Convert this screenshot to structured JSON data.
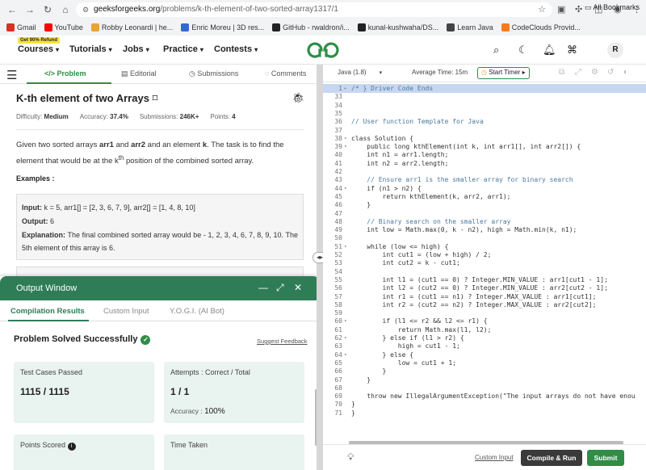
{
  "browser": {
    "url_host": "geeksforgeeks.org",
    "url_path": "/problems/k-th-element-of-two-sorted-array1317/1",
    "bookmarks": [
      {
        "label": "Gmail",
        "color": "#d93025"
      },
      {
        "label": "YouTube",
        "color": "#ff0000"
      },
      {
        "label": "Robby Leonardi | he...",
        "color": "#e8a33a"
      },
      {
        "label": "Enric Moreu | 3D res...",
        "color": "#3367d6"
      },
      {
        "label": "GitHub - rwaldron/i...",
        "color": "#222222"
      },
      {
        "label": "kunal-kushwaha/DS...",
        "color": "#222222"
      },
      {
        "label": "Learn Java",
        "color": "#444444"
      },
      {
        "label": "CodeClouds Provid...",
        "color": "#f47b20"
      }
    ],
    "all_bookmarks": "All Bookmarks"
  },
  "header": {
    "refund_badge": "Get 90% Refund",
    "nav": [
      "Courses",
      "Tutorials",
      "Jobs",
      "Practice",
      "Contests"
    ],
    "avatar": "R"
  },
  "problem": {
    "tabs": [
      "Problem",
      "Editorial",
      "Submissions",
      "Comments"
    ],
    "title": "K-th element of two Arrays",
    "difficulty_label": "Difficulty:",
    "difficulty": "Medium",
    "accuracy_label": "Accuracy:",
    "accuracy": "37.4%",
    "submissions_label": "Submissions:",
    "submissions": "246K+",
    "points_label": "Points:",
    "points": "4",
    "desc_1": "Given two sorted arrays ",
    "arr1": "arr1",
    "desc_and": " and ",
    "arr2": "arr2",
    "desc_2": " and an element ",
    "k": "k",
    "desc_3": ". The task is to find the element that would be at the k",
    "sup": "th",
    "desc_4": " position of the combined sorted array.",
    "examples_label": "Examples :",
    "input_label": "Input:",
    "input_value": " k = 5, arr1[] = [2, 3, 6, 7, 9], arr2[] = [1, 4, 8, 10]",
    "output_label": "Output:",
    "output_value": " 6",
    "explanation_label": "Explanation:",
    "explanation_value": " The final combined sorted array would be - 1, 2, 3, 4, 6, 7, 8, 9, 10. The 5th element of this array is 6."
  },
  "output_window": {
    "title": "Output Window",
    "tabs": [
      "Compilation Results",
      "Custom Input",
      "Y.O.G.I. (AI Bot)"
    ],
    "status": "Problem Solved Successfully",
    "suggest_feedback": "Suggest Feedback",
    "test_cases_label": "Test Cases Passed",
    "test_cases_value": "1115 / 1115",
    "attempts_label": "Attempts : Correct / Total",
    "attempts_value": "1 / 1",
    "accuracy_label": "Accuracy :",
    "accuracy_value": "100%",
    "points_scored_label": "Points Scored",
    "time_taken_label": "Time Taken"
  },
  "editor": {
    "language": "Java (1.8)",
    "avg_time": "Average Time: 15m",
    "start_timer": "Start Timer",
    "custom_input": "Custom Input",
    "compile_run": "Compile & Run",
    "submit": "Submit",
    "lines": [
      {
        "n": "1",
        "f": "▸",
        "t": "/* } Driver Code Ends",
        "cls": "cm",
        "hl": true
      },
      {
        "n": "33",
        "f": "",
        "t": ""
      },
      {
        "n": "34",
        "f": "",
        "t": ""
      },
      {
        "n": "35",
        "f": "",
        "t": ""
      },
      {
        "n": "36",
        "f": "",
        "t": "// User function Template for Java",
        "cls": "cm"
      },
      {
        "n": "37",
        "f": "",
        "t": ""
      },
      {
        "n": "38",
        "f": "▾",
        "t": "class Solution {"
      },
      {
        "n": "39",
        "f": "▾",
        "t": "    public long kthElement(int k, int arr1[], int arr2[]) {"
      },
      {
        "n": "40",
        "f": "",
        "t": "    int n1 = arr1.length;"
      },
      {
        "n": "41",
        "f": "",
        "t": "    int n2 = arr2.length;"
      },
      {
        "n": "42",
        "f": "",
        "t": ""
      },
      {
        "n": "43",
        "f": "",
        "t": "    // Ensure arr1 is the smaller array for binary search",
        "cls": "cm"
      },
      {
        "n": "44",
        "f": "▾",
        "t": "    if (n1 > n2) {"
      },
      {
        "n": "45",
        "f": "",
        "t": "        return kthElement(k, arr2, arr1);"
      },
      {
        "n": "46",
        "f": "",
        "t": "    }"
      },
      {
        "n": "47",
        "f": "",
        "t": ""
      },
      {
        "n": "48",
        "f": "",
        "t": "    // Binary search on the smaller array",
        "cls": "cm"
      },
      {
        "n": "49",
        "f": "",
        "t": "    int low = Math.max(0, k - n2), high = Math.min(k, n1);"
      },
      {
        "n": "50",
        "f": "",
        "t": ""
      },
      {
        "n": "51",
        "f": "▾",
        "t": "    while (low <= high) {"
      },
      {
        "n": "52",
        "f": "",
        "t": "        int cut1 = (low + high) / 2;"
      },
      {
        "n": "53",
        "f": "",
        "t": "        int cut2 = k - cut1;"
      },
      {
        "n": "54",
        "f": "",
        "t": ""
      },
      {
        "n": "55",
        "f": "",
        "t": "        int l1 = (cut1 == 0) ? Integer.MIN_VALUE : arr1[cut1 - 1];"
      },
      {
        "n": "56",
        "f": "",
        "t": "        int l2 = (cut2 == 0) ? Integer.MIN_VALUE : arr2[cut2 - 1];"
      },
      {
        "n": "57",
        "f": "",
        "t": "        int r1 = (cut1 == n1) ? Integer.MAX_VALUE : arr1[cut1];"
      },
      {
        "n": "58",
        "f": "",
        "t": "        int r2 = (cut2 == n2) ? Integer.MAX_VALUE : arr2[cut2];"
      },
      {
        "n": "59",
        "f": "",
        "t": ""
      },
      {
        "n": "60",
        "f": "▾",
        "t": "        if (l1 <= r2 && l2 <= r1) {"
      },
      {
        "n": "61",
        "f": "",
        "t": "            return Math.max(l1, l2);"
      },
      {
        "n": "62",
        "f": "▾",
        "t": "        } else if (l1 > r2) {"
      },
      {
        "n": "63",
        "f": "",
        "t": "            high = cut1 - 1;"
      },
      {
        "n": "64",
        "f": "▾",
        "t": "        } else {"
      },
      {
        "n": "65",
        "f": "",
        "t": "            low = cut1 + 1;"
      },
      {
        "n": "66",
        "f": "",
        "t": "        }"
      },
      {
        "n": "67",
        "f": "",
        "t": "    }"
      },
      {
        "n": "68",
        "f": "",
        "t": ""
      },
      {
        "n": "69",
        "f": "",
        "t": "    throw new IllegalArgumentException(\"The input arrays do not have enou"
      },
      {
        "n": "70",
        "f": "",
        "t": "}"
      },
      {
        "n": "71",
        "f": "",
        "t": "}"
      }
    ]
  }
}
